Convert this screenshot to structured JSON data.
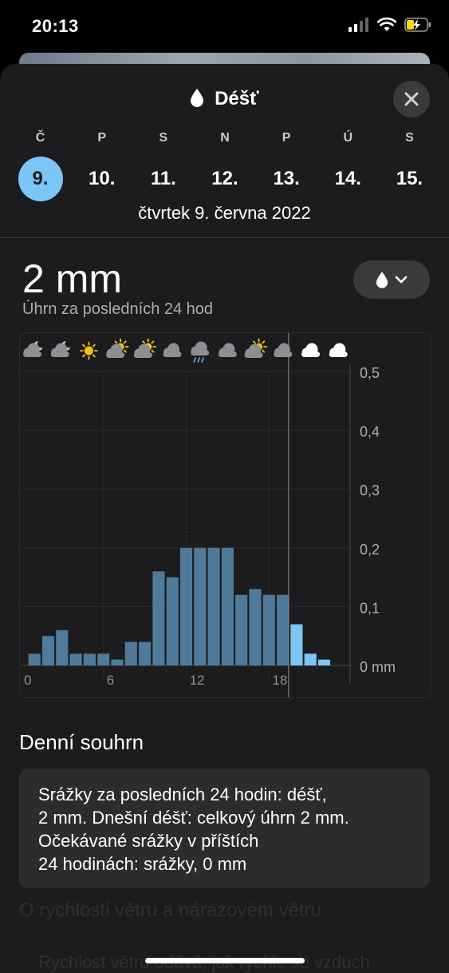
{
  "status": {
    "time": "20:13"
  },
  "sheet": {
    "title": "Déšť"
  },
  "days": [
    {
      "abbr": "Č",
      "num": "9.",
      "selected": true
    },
    {
      "abbr": "P",
      "num": "10."
    },
    {
      "abbr": "S",
      "num": "11."
    },
    {
      "abbr": "N",
      "num": "12."
    },
    {
      "abbr": "P",
      "num": "13."
    },
    {
      "abbr": "Ú",
      "num": "14."
    },
    {
      "abbr": "S",
      "num": "15."
    }
  ],
  "full_date": "čtvrtek 9. června 2022",
  "metric": {
    "value": "2 mm",
    "subtitle": "Úhrn za posledních 24 hod",
    "picker_icon": "drop-icon"
  },
  "weather_icons": [
    "cloud-moon",
    "cloud-moon",
    "sun",
    "cloud-sun",
    "cloud-sun",
    "cloud",
    "cloud-rain",
    "cloud",
    "cloud-sun",
    "cloud",
    "cloud",
    "cloud"
  ],
  "chart_data": {
    "type": "bar",
    "x_ticks": [
      "0",
      "6",
      "12",
      "18"
    ],
    "y_ticks": [
      "0 mm",
      "0,1",
      "0,2",
      "0,3",
      "0,4",
      "0,5"
    ],
    "ylim": [
      0,
      0.5
    ],
    "hours": [
      1,
      2,
      3,
      4,
      5,
      6,
      7,
      8,
      9,
      10,
      11,
      12,
      13,
      14,
      15,
      16,
      17,
      18,
      19,
      20,
      21,
      22
    ],
    "values": [
      0.02,
      0.05,
      0.06,
      0.02,
      0.02,
      0.02,
      0.01,
      0.04,
      0.04,
      0.16,
      0.15,
      0.2,
      0.2,
      0.2,
      0.2,
      0.12,
      0.13,
      0.12,
      0.12,
      0.07,
      0.02,
      0.01
    ],
    "current_hour": 20,
    "colors": {
      "past": "#4f7a99",
      "forecast": "#7cc6f4"
    }
  },
  "summary": {
    "heading": "Denní souhrn",
    "lines": [
      "Srážky za posledních 24 hodin: déšť,",
      "2 mm. Dnešní déšť: celkový úhrn 2 mm.",
      "Očekávané srážky v příštích",
      "24 hodinách: srážky, 0 mm"
    ]
  },
  "faded": {
    "line1": "O rychlosti větru a nárazovém větru",
    "line2": "Rychlost větru udává, jak rychle se vzduch"
  },
  "colors": {
    "accent": "#7cc6f4",
    "sheet": "#1c1c1e",
    "card": "#2c2c2e"
  }
}
